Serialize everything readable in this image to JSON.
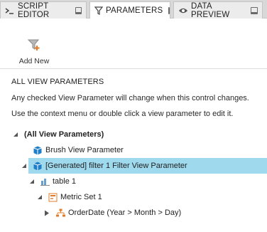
{
  "tabs": [
    {
      "label": "SCRIPT EDITOR",
      "icon": "script-icon",
      "active": false
    },
    {
      "label": "PARAMETERS",
      "icon": "filter-icon",
      "active": true
    },
    {
      "label": "DATA PREVIEW",
      "icon": "eye-icon",
      "active": false
    }
  ],
  "toolbar": {
    "add_new_label": "Add New"
  },
  "panel": {
    "section_title": "ALL VIEW PARAMETERS",
    "info_line_1": "Any checked View Parameter will change when this control changes.",
    "info_line_2": "Use the context menu or double click a view parameter to edit it."
  },
  "tree": {
    "root": "(All View Parameters)",
    "brush_param": "Brush View Parameter",
    "filter_param": "[Generated] filter 1 Filter View Parameter",
    "table": "table 1",
    "metric_set": "Metric Set 1",
    "order_date": "OrderDate (Year > Month > Day)"
  },
  "colors": {
    "selection": "#9fd9ee",
    "accent_blue": "#1e7fc8",
    "accent_orange": "#e07b2a"
  }
}
